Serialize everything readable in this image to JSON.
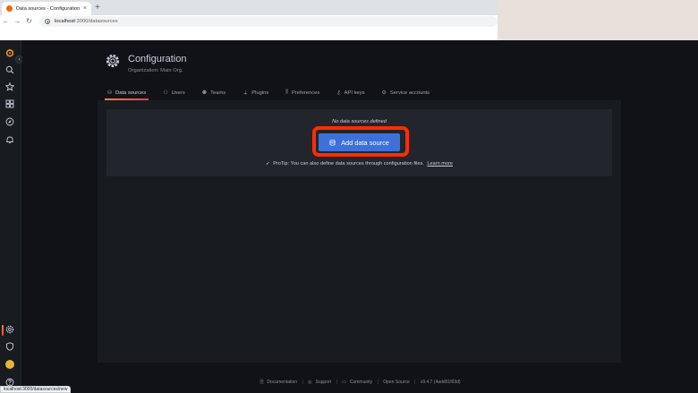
{
  "browser": {
    "tab_title": "Data sources - Configuration",
    "tab_close": "×",
    "new_tab": "+",
    "back": "←",
    "forward": "→",
    "reload": "↻",
    "url_host": "localhost",
    "url_path": ":3000/datasources",
    "status_url": "localhost:3000/datasources/new"
  },
  "sidebar": {
    "expand": "›",
    "icons": [
      "grafana-logo-icon",
      "search-icon",
      "star-icon",
      "dashboards-icon",
      "explore-icon",
      "alerting-icon",
      "configuration-icon",
      "shield-icon",
      "user-avatar-icon",
      "help-icon"
    ]
  },
  "header": {
    "title": "Configuration",
    "subtitle": "Organization: Main Org."
  },
  "tabs": [
    {
      "label": "Data sources",
      "icon": "database-icon",
      "active": true
    },
    {
      "label": "Users",
      "icon": "user-icon",
      "active": false
    },
    {
      "label": "Teams",
      "icon": "users-icon",
      "active": false
    },
    {
      "label": "Plugins",
      "icon": "plug-icon",
      "active": false
    },
    {
      "label": "Preferences",
      "icon": "sliders-icon",
      "active": false
    },
    {
      "label": "API keys",
      "icon": "key-icon",
      "active": false
    },
    {
      "label": "Service accounts",
      "icon": "user-cog-icon",
      "active": false
    }
  ],
  "empty": {
    "message": "No data sources defined",
    "button_label": "Add data source",
    "protip_text": "ProTip: You can also define data sources through configuration files.",
    "learn_more": "Learn more"
  },
  "footer": {
    "documentation": "Documentation",
    "support": "Support",
    "community": "Community",
    "open_source": "Open Source",
    "version": "v9.4.7 (4add91f03d)",
    "separator": "|"
  },
  "colors": {
    "accent": "#3d71d9",
    "highlight": "#ff2d00",
    "tab_underline": "#f53e4c",
    "background": "#111217"
  }
}
